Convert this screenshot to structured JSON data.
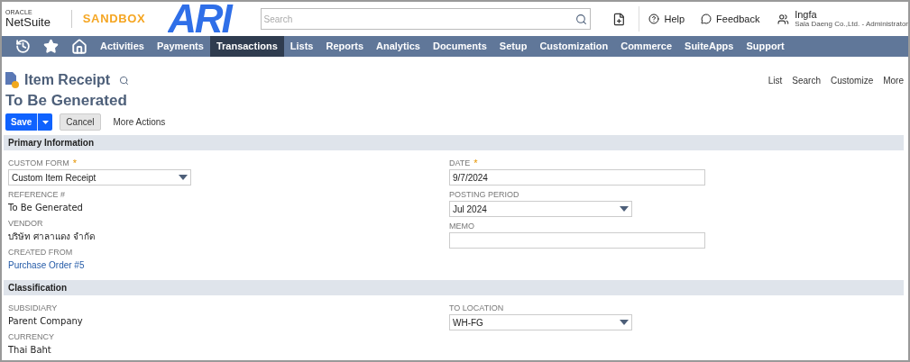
{
  "header": {
    "oracle": "ORACLE",
    "netsuite": "NetSuite",
    "environment": "SANDBOX",
    "logo": "ARI",
    "search": {
      "placeholder": "Search"
    },
    "help": "Help",
    "feedback": "Feedback",
    "user": {
      "name": "Ingfa",
      "role": "Sala Daeng Co.,Ltd. - Administrator"
    }
  },
  "nav": [
    {
      "kind": "icon",
      "selected": false
    },
    {
      "kind": "icon",
      "selected": false
    },
    {
      "kind": "icon",
      "selected": false
    },
    {
      "kind": "text",
      "label": "Activities",
      "selected": false
    },
    {
      "kind": "text",
      "label": "Payments",
      "selected": false
    },
    {
      "kind": "text",
      "label": "Transactions",
      "selected": true
    },
    {
      "kind": "text",
      "label": "Lists",
      "selected": false
    },
    {
      "kind": "text",
      "label": "Reports",
      "selected": false
    },
    {
      "kind": "text",
      "label": "Analytics",
      "selected": false
    },
    {
      "kind": "text",
      "label": "Documents",
      "selected": false
    },
    {
      "kind": "text",
      "label": "Setup",
      "selected": false
    },
    {
      "kind": "text",
      "label": "Customization",
      "selected": false
    },
    {
      "kind": "text",
      "label": "Commerce",
      "selected": false
    },
    {
      "kind": "text",
      "label": "SuiteApps",
      "selected": false
    },
    {
      "kind": "text",
      "label": "Support",
      "selected": false
    }
  ],
  "page": {
    "title": "Item Receipt",
    "subtitle": "To Be Generated",
    "links": [
      "List",
      "Search",
      "Customize",
      "More"
    ],
    "buttons": {
      "save": "Save",
      "cancel": "Cancel",
      "more_actions": "More Actions"
    }
  },
  "sections": [
    {
      "title": "Primary Information",
      "left": [
        {
          "label": "CUSTOM FORM",
          "required_mark": "*",
          "kind": "select",
          "value": "Custom Item Receipt"
        },
        {
          "label": "REFERENCE #",
          "kind": "text",
          "value": "To Be Generated"
        },
        {
          "label": "VENDOR",
          "kind": "text",
          "value": "บริษัท ศาลาแดง จำกัด"
        },
        {
          "label": "CREATED FROM",
          "kind": "link",
          "value": "Purchase Order #5"
        }
      ],
      "right": [
        {
          "label": "DATE",
          "required_mark": "*",
          "kind": "input",
          "value": "9/7/2024"
        },
        {
          "label": "POSTING PERIOD",
          "kind": "select",
          "value": "Jul 2024"
        },
        {
          "label": "MEMO",
          "kind": "input"
        }
      ]
    },
    {
      "title": "Classification",
      "left": [
        {
          "label": "SUBSIDIARY",
          "kind": "text",
          "value": "Parent Company"
        },
        {
          "label": "CURRENCY",
          "kind": "text",
          "value": "Thai Baht"
        }
      ],
      "right": [
        {
          "label": "TO LOCATION",
          "kind": "select",
          "value": "WH-FG"
        }
      ]
    }
  ]
}
